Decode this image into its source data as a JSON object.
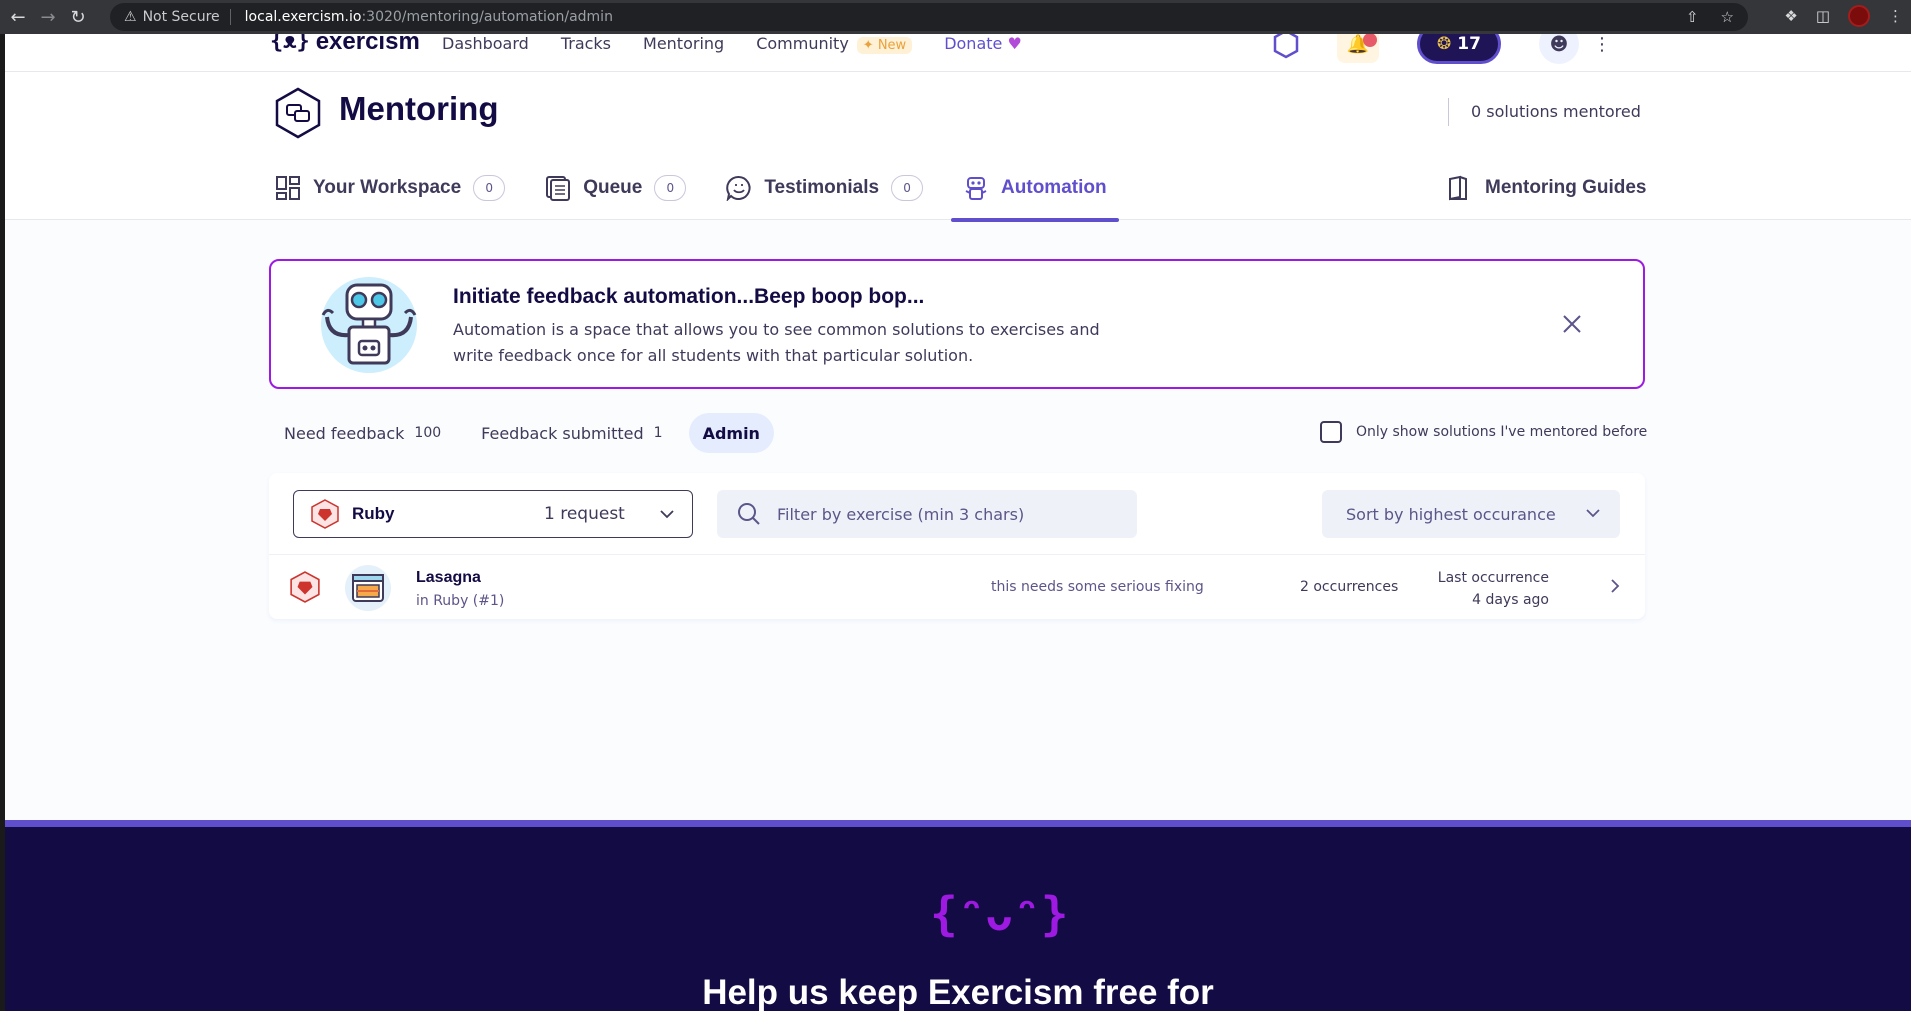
{
  "browser": {
    "security_label": "Not Secure",
    "url_host": "local.exercism.io",
    "url_path": ":3020/mentoring/automation/admin"
  },
  "site_header": {
    "logo_text": "exercism",
    "nav": [
      {
        "label": "Dashboard"
      },
      {
        "label": "Tracks"
      },
      {
        "label": "Mentoring"
      },
      {
        "label": "Community"
      },
      {
        "label": "Donate"
      }
    ],
    "community_badge": "New",
    "reputation": "17"
  },
  "mentoring": {
    "title": "Mentoring",
    "solutions_mentored": "0 solutions mentored",
    "tabs": [
      {
        "label": "Your Workspace",
        "count": "0"
      },
      {
        "label": "Queue",
        "count": "0"
      },
      {
        "label": "Testimonials",
        "count": "0"
      },
      {
        "label": "Automation"
      }
    ],
    "guides_label": "Mentoring Guides"
  },
  "intro": {
    "title": "Initiate feedback automation...Beep boop bop...",
    "text": "Automation is a space that allows you to see common solutions to exercises and write feedback once for all students with that particular solution."
  },
  "subtabs": [
    {
      "label": "Need feedback",
      "count": "100"
    },
    {
      "label": "Feedback submitted",
      "count": "1"
    },
    {
      "label": "Admin"
    }
  ],
  "only_mentored_label": "Only show solutions I've mentored before",
  "filters": {
    "track_name": "Ruby",
    "track_requests": "1 request",
    "search_placeholder": "Filter by exercise (min 3 chars)",
    "sort_label": "Sort by highest occurance"
  },
  "rows": [
    {
      "exercise": "Lasagna",
      "track": "in Ruby (#1)",
      "feedback": "this needs some serious fixing",
      "occurrences": "2 occurrences",
      "last_label": "Last occurrence",
      "last_time": "4 days ago"
    }
  ],
  "footer": {
    "logo": "{ᵔᴗᵔ}",
    "title": "Help us keep Exercism free for"
  },
  "colors": {
    "primary": "#604fcd",
    "dark": "#130b43",
    "banner_border": "#9e1ae2",
    "ruby": "#cc342d"
  }
}
